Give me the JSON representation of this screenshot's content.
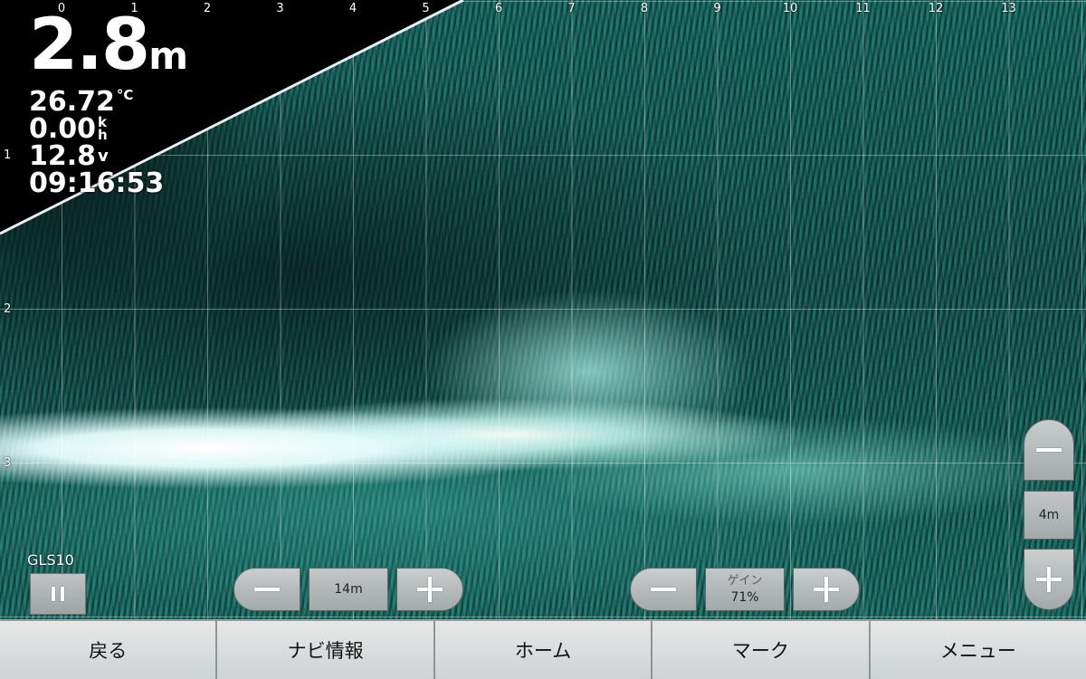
{
  "sonar": {
    "x_axis_labels": [
      "0",
      "1",
      "2",
      "3",
      "4",
      "5",
      "6",
      "7",
      "8",
      "9",
      "10",
      "11",
      "12",
      "13"
    ],
    "y_axis_labels": [
      "1",
      "2",
      "3"
    ]
  },
  "readouts": {
    "depth_value": "2.8",
    "depth_unit": "m",
    "water_temp_value": "26.72",
    "water_temp_unit": "°C",
    "speed_value": "0.00",
    "speed_unit_top": "k",
    "speed_unit_bottom": "h",
    "voltage_value": "12.8",
    "voltage_unit": "v",
    "time": "09:16:53"
  },
  "source": {
    "label": "GLS10",
    "pause_icon": "pause-icon"
  },
  "range_control": {
    "value": "14m"
  },
  "gain_control": {
    "label": "ゲイン",
    "value": "71%"
  },
  "vertical_zoom": {
    "value": "4m"
  },
  "navbar": {
    "back": "戻る",
    "nav_info": "ナビ情報",
    "home": "ホーム",
    "mark": "マーク",
    "menu": "メニュー"
  },
  "colors": {
    "sonar_teal": "#1a6a63",
    "sonar_return_white": "#ffffff",
    "button_gray": "#b4b9b9",
    "nav_bg": "#dcdfdf"
  }
}
